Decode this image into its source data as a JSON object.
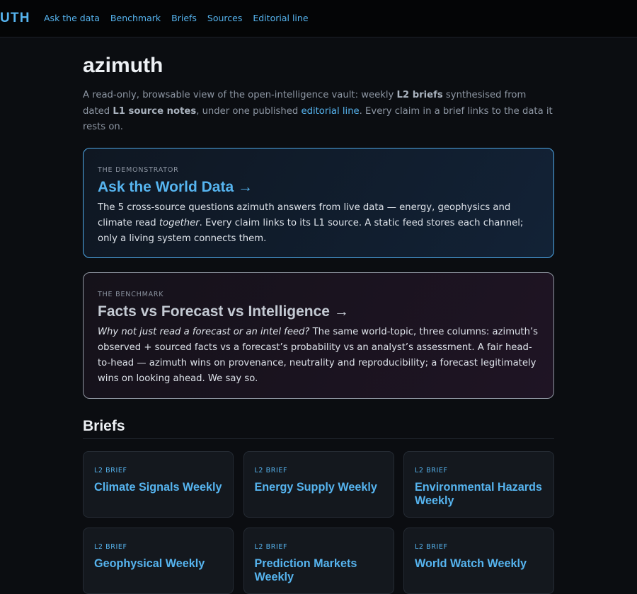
{
  "brand": "UTH",
  "nav": [
    {
      "label": "Ask the data"
    },
    {
      "label": "Benchmark"
    },
    {
      "label": "Briefs"
    },
    {
      "label": "Sources"
    },
    {
      "label": "Editorial line"
    }
  ],
  "page": {
    "title": "azimuth",
    "intro": {
      "t1": "A read-only, browsable view of the open-intelligence vault: weekly ",
      "b1": "L2 briefs",
      "t2": " synthesised from dated ",
      "b2": "L1 source notes",
      "t3": ", under one published ",
      "link": "editorial line",
      "t4": ". Every claim in a brief links to the data it rests on."
    }
  },
  "features": {
    "ask": {
      "eyebrow": "THE DEMONSTRATOR",
      "title": "Ask the World Data →",
      "t1": "The 5 cross-source questions azimuth answers from live data — energy, geophysics and climate read ",
      "em": "together",
      "t2": ". Every claim links to its L1 source. A static feed stores each channel; only a living system connects them."
    },
    "benchmark": {
      "eyebrow": "THE BENCHMARK",
      "title": "Facts vs Forecast vs Intelligence →",
      "em": "Why not just read a forecast or an intel feed?",
      "t1": " The same world-topic, three columns: azimuth’s observed + sourced facts vs a forecast’s probability vs an analyst’s assessment. A fair head-to-head — azimuth wins on provenance, neutrality and reproducibility; a forecast legitimately wins on looking ahead. We say so."
    }
  },
  "briefs": {
    "title": "Briefs",
    "items": [
      {
        "eyebrow": "L2 BRIEF",
        "title": "Climate Signals Weekly"
      },
      {
        "eyebrow": "L2 BRIEF",
        "title": "Energy Supply Weekly"
      },
      {
        "eyebrow": "L2 BRIEF",
        "title": "Environmental Hazards Weekly"
      },
      {
        "eyebrow": "L2 BRIEF",
        "title": "Geophysical Weekly"
      },
      {
        "eyebrow": "L2 BRIEF",
        "title": "Prediction Markets Weekly"
      },
      {
        "eyebrow": "L2 BRIEF",
        "title": "World Watch Weekly"
      }
    ]
  }
}
